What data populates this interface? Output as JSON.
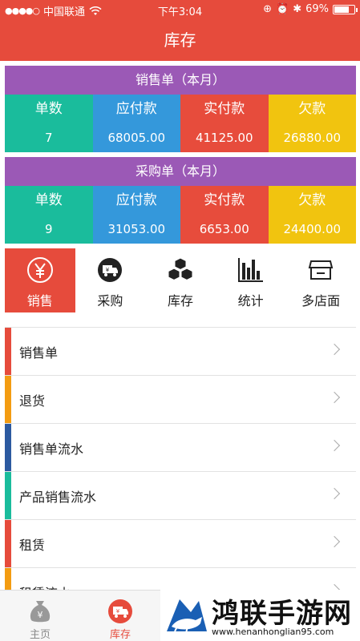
{
  "status_bar": {
    "carrier": "中国联通",
    "time": "下午3:04",
    "battery": "69%"
  },
  "nav": {
    "title": "库存"
  },
  "sales_summary": {
    "title": "销售单（本月）",
    "columns": [
      {
        "label": "单数",
        "value": "7"
      },
      {
        "label": "应付款",
        "value": "68005.00"
      },
      {
        "label": "实付款",
        "value": "41125.00"
      },
      {
        "label": "欠款",
        "value": "26880.00"
      }
    ]
  },
  "purchase_summary": {
    "title": "采购单（本月）",
    "columns": [
      {
        "label": "单数",
        "value": "9"
      },
      {
        "label": "应付款",
        "value": "31053.00"
      },
      {
        "label": "实付款",
        "value": "6653.00"
      },
      {
        "label": "欠款",
        "value": "24400.00"
      }
    ]
  },
  "quick_actions": [
    {
      "label": "销售",
      "icon": "yuan-circle-icon",
      "active": true
    },
    {
      "label": "采购",
      "icon": "truck-icon",
      "active": false
    },
    {
      "label": "库存",
      "icon": "boxes-icon",
      "active": false
    },
    {
      "label": "统计",
      "icon": "bar-chart-icon",
      "active": false
    },
    {
      "label": "多店面",
      "icon": "store-icon",
      "active": false
    }
  ],
  "menu": [
    {
      "label": "销售单",
      "color": "#e64b3c"
    },
    {
      "label": "退货",
      "color": "#f39c12"
    },
    {
      "label": "销售单流水",
      "color": "#2c5aa0"
    },
    {
      "label": "产品销售流水",
      "color": "#1abc9c"
    },
    {
      "label": "租赁",
      "color": "#e64b3c"
    },
    {
      "label": "租赁流水",
      "color": "#f39c12"
    }
  ],
  "tabs": [
    {
      "label": "主页",
      "icon": "money-bag-icon"
    },
    {
      "label": "库存",
      "icon": "yuan-truck-icon"
    }
  ],
  "banner": {
    "title": "鸿联手游网",
    "url": "www.henanhonglian95.com"
  },
  "colors": {
    "primary": "#e64b3c",
    "purple": "#9b59b6",
    "teal": "#1abc9c",
    "blue": "#3498db",
    "red": "#e74c3c",
    "yellow": "#f1c40f"
  }
}
